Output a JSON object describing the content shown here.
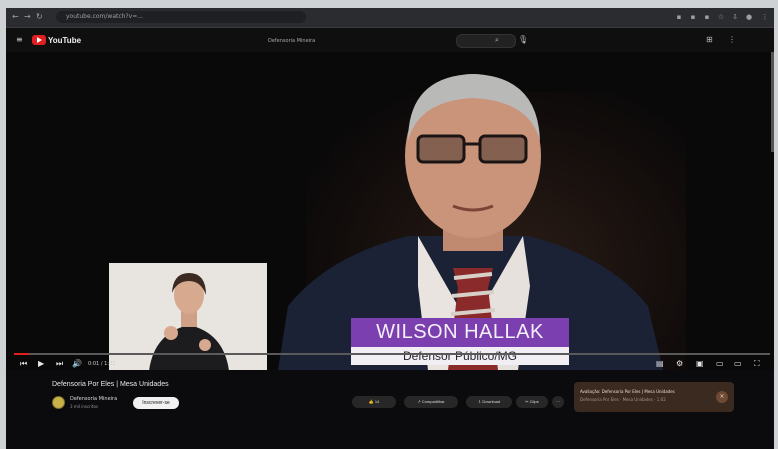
{
  "browser": {
    "url": "youtube.com/watch?v=...",
    "back_icon": "arrow-left-icon",
    "forward_icon": "arrow-right-icon",
    "reload_icon": "reload-icon"
  },
  "youtube": {
    "logo_text": "YouTube",
    "search_text": "Defensoria Mineira"
  },
  "video": {
    "name_label": "WILSON HALLAK",
    "role_label": "Defensor Público/MG",
    "progress": 0.02,
    "time": "0:01 / 1:02"
  },
  "below": {
    "title": "Defensoria Por Eles | Mesa Unidades",
    "channel": "Defensoria Mineira",
    "subscribers": "3 mil inscritos",
    "subscribe_label": "Inscrever-se",
    "like_label": "14",
    "share_label": "Compartilhar",
    "download_label": "Download",
    "clip_label": "Clipe"
  },
  "notification": {
    "line1": "Avaliação: Defensoria Por Eles | Mesa Unidades",
    "line2": "Defensoria Por Eles · Mesa Unidades · 1:02"
  }
}
